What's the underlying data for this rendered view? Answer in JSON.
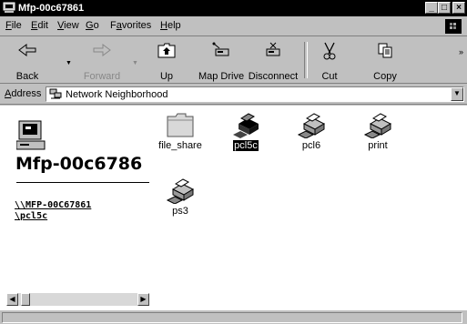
{
  "window": {
    "title": "Mfp-00c67861"
  },
  "title_buttons": {
    "minimize": "_",
    "maximize": "□",
    "close": "×"
  },
  "menu": [
    {
      "label": "File",
      "key": "F",
      "rest": "ile"
    },
    {
      "label": "Edit",
      "key": "E",
      "rest": "dit"
    },
    {
      "label": "View",
      "key": "V",
      "rest": "iew"
    },
    {
      "label": "Go",
      "key": "G",
      "rest": "o"
    },
    {
      "label": "Favorites",
      "key": "a",
      "pre": "F",
      "rest": "vorites"
    },
    {
      "label": "Help",
      "key": "H",
      "rest": "elp"
    }
  ],
  "toolbar": {
    "back": "Back",
    "forward": "Forward",
    "up": "Up",
    "map_drive": "Map Drive",
    "disconnect": "Disconnect",
    "cut": "Cut",
    "copy": "Copy",
    "more": "»"
  },
  "address": {
    "label_pre": "A",
    "label_rest": "ddress",
    "value": "Network Neighborhood",
    "dropdown": "▼"
  },
  "left_pane": {
    "title": "Mfp-00c6786",
    "link1": "\\\\MFP-00C67861",
    "link2": "\\pcl5c"
  },
  "scrollbar": {
    "left": "◀",
    "right": "▶"
  },
  "items": [
    {
      "label": "file_share",
      "type": "folder",
      "selected": false
    },
    {
      "label": "pcl5c",
      "type": "printer",
      "selected": true
    },
    {
      "label": "pcl6",
      "type": "printer",
      "selected": false
    },
    {
      "label": "print",
      "type": "printer",
      "selected": false
    },
    {
      "label": "ps3",
      "type": "printer",
      "selected": false
    }
  ],
  "status": {
    "text": ""
  }
}
